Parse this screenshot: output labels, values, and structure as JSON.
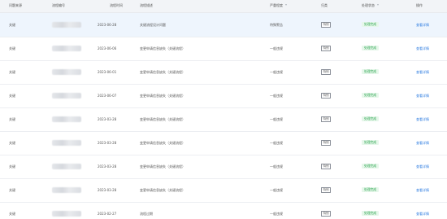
{
  "table": {
    "headers": {
      "type": "问题来源",
      "id": "流程编号",
      "date": "流程时间",
      "desc": "流程描述",
      "severity": "严重程度",
      "category": "归类",
      "status": "处理状态",
      "action": "操作"
    },
    "rows": [
      {
        "type": "关键",
        "date": "2023-06-28",
        "desc": "关键流程设计问题",
        "severity": "特殊警告",
        "category": "特别",
        "status": "处理完成",
        "action": "查看详情"
      },
      {
        "type": "关键",
        "date": "2023-06-06",
        "desc": "变更申请信息缺失（关键流程）",
        "severity": "一般违规",
        "category": "特别",
        "status": "处理完成",
        "action": "查看详情"
      },
      {
        "type": "关键",
        "date": "2023-06-01",
        "desc": "变更申请信息缺失（关键流程）",
        "severity": "一般违规",
        "category": "特别",
        "status": "处理完成",
        "action": "查看详情"
      },
      {
        "type": "关键",
        "date": "2023-06-07",
        "desc": "变更申请信息缺失（关键流程）",
        "severity": "一般违规",
        "category": "特别",
        "status": "处理完成",
        "action": "查看详情"
      },
      {
        "type": "关键",
        "date": "2023-03-28",
        "desc": "变更申请信息缺失（关键流程）",
        "severity": "一般违规",
        "category": "特别",
        "status": "处理完成",
        "action": "查看详情"
      },
      {
        "type": "关键",
        "date": "2023-03-28",
        "desc": "变更申请信息缺失（关键流程）",
        "severity": "一般违规",
        "category": "特别",
        "status": "处理完成",
        "action": "查看详情"
      },
      {
        "type": "关键",
        "date": "2023-03-28",
        "desc": "变更申请信息缺失（关键流程）",
        "severity": "一般违规",
        "category": "特别",
        "status": "处理完成",
        "action": "查看详情"
      },
      {
        "type": "关键",
        "date": "2023-03-28",
        "desc": "变更申请信息缺失（关键流程）",
        "severity": "一般违规",
        "category": "特别",
        "status": "处理完成",
        "action": "查看详情"
      },
      {
        "type": "关键",
        "date": "2023-02-27",
        "desc": "流程过期",
        "severity": "一般违规",
        "category": "特别",
        "status": "处理完成",
        "action": "查看详情"
      }
    ]
  },
  "colors": {
    "link": "#2f7de1",
    "status_bg": "#e6f7ea",
    "status_fg": "#2ea652",
    "selected_row": "#eef5fd",
    "header_bg": "#f2f4f7"
  },
  "icons": {
    "severity_filter": "filter-icon",
    "status_filter": "filter-icon"
  }
}
